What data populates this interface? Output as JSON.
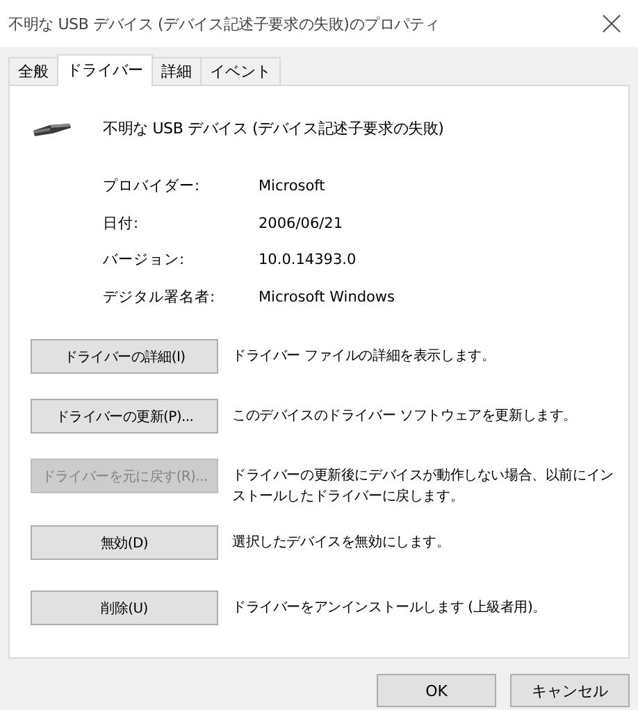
{
  "window": {
    "title": "不明な USB デバイス (デバイス記述子要求の失敗)のプロパティ"
  },
  "tabs": [
    {
      "label": "全般",
      "selected": false
    },
    {
      "label": "ドライバー",
      "selected": true
    },
    {
      "label": "詳細",
      "selected": false
    },
    {
      "label": "イベント",
      "selected": false
    }
  ],
  "device": {
    "name": "不明な USB デバイス (デバイス記述子要求の失敗)"
  },
  "properties": [
    {
      "label": "プロバイダー:",
      "value": "Microsoft"
    },
    {
      "label": "日付:",
      "value": "2006/06/21"
    },
    {
      "label": "バージョン:",
      "value": "10.0.14393.0"
    },
    {
      "label": "デジタル署名者:",
      "value": "Microsoft Windows"
    }
  ],
  "actions": [
    {
      "button": "ドライバーの詳細(I)",
      "description": "ドライバー ファイルの詳細を表示します。",
      "disabled": false
    },
    {
      "button": "ドライバーの更新(P)...",
      "description": "このデバイスのドライバー ソフトウェアを更新します。",
      "disabled": false
    },
    {
      "button": "ドライバーを元に戻す(R)...",
      "description": "ドライバーの更新後にデバイスが動作しない場合、以前にインストールしたドライバーに戻します。",
      "disabled": true
    },
    {
      "button": "無効(D)",
      "description": "選択したデバイスを無効にします。",
      "disabled": false
    },
    {
      "button": "削除(U)",
      "description": "ドライバーをアンインストールします (上級者用)。",
      "disabled": false
    }
  ],
  "buttons": [
    {
      "label": "OK"
    },
    {
      "label": "キャンセル"
    }
  ]
}
